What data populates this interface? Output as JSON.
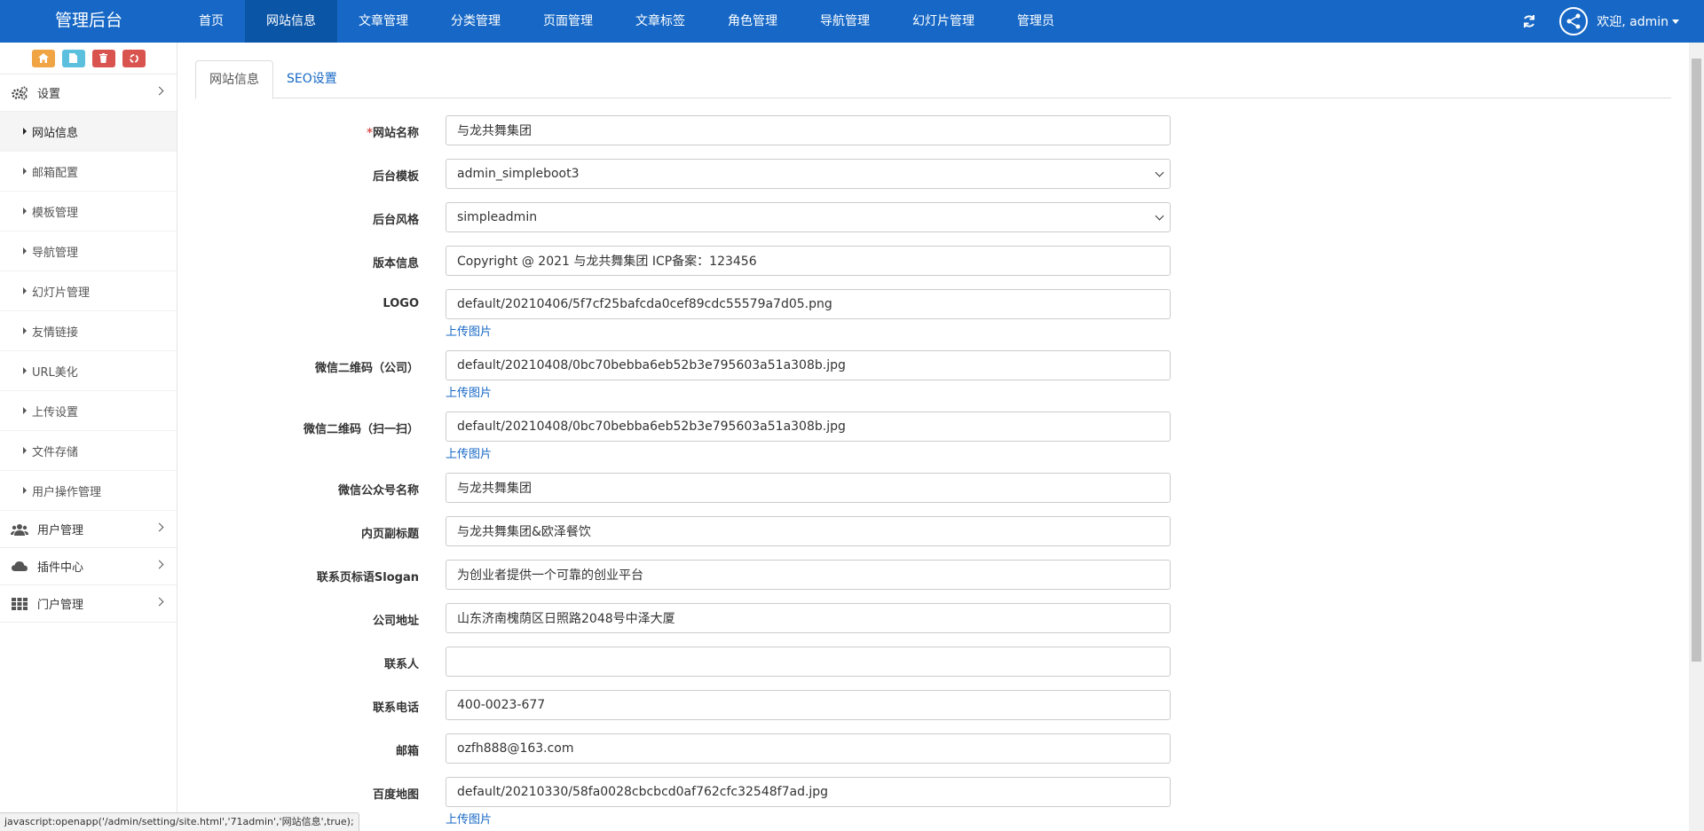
{
  "brand": "管理后台",
  "topnav": [
    "首页",
    "网站信息",
    "文章管理",
    "分类管理",
    "页面管理",
    "文章标签",
    "角色管理",
    "导航管理",
    "幻灯片管理",
    "管理员"
  ],
  "user": {
    "welcome": "欢迎, admin"
  },
  "sidebar": {
    "settings_label": "设置",
    "sub_items": [
      "网站信息",
      "邮箱配置",
      "模板管理",
      "导航管理",
      "幻灯片管理",
      "友情链接",
      "URL美化",
      "上传设置",
      "文件存储",
      "用户操作管理"
    ],
    "groups": [
      "用户管理",
      "插件中心",
      "门户管理"
    ]
  },
  "tabs": {
    "site_info": "网站信息",
    "seo": "SEO设置"
  },
  "form": {
    "upload_label": "上传图片",
    "fields": [
      {
        "label": "网站名称",
        "required": true,
        "value": "与龙共舞集团"
      },
      {
        "label": "后台模板",
        "value": "admin_simpleboot3"
      },
      {
        "label": "后台风格",
        "value": "simpleadmin"
      },
      {
        "label": "版本信息",
        "value": "Copyright @ 2021 与龙共舞集团 ICP备案：123456"
      },
      {
        "label": "LOGO",
        "value": "default/20210406/5f7cf25bafcda0cef89cdc55579a7d05.png"
      },
      {
        "label": "微信二维码（公司）",
        "value": "default/20210408/0bc70bebba6eb52b3e795603a51a308b.jpg"
      },
      {
        "label": "微信二维码（扫一扫）",
        "value": "default/20210408/0bc70bebba6eb52b3e795603a51a308b.jpg"
      },
      {
        "label": "微信公众号名称",
        "value": "与龙共舞集团"
      },
      {
        "label": "内页副标题",
        "value": "与龙共舞集团&欧泽餐饮"
      },
      {
        "label": "联系页标语Slogan",
        "value": "为创业者提供一个可靠的创业平台"
      },
      {
        "label": "公司地址",
        "value": "山东济南槐荫区日照路2048号中泽大厦"
      },
      {
        "label": "联系人",
        "value": ""
      },
      {
        "label": "联系电话",
        "value": "400-0023-677"
      },
      {
        "label": "邮箱",
        "value": "ozfh888@163.com"
      },
      {
        "label": "百度地图",
        "value": "default/20210330/58fa0028cbcbcd0af762cfc32548f7ad.jpg"
      }
    ]
  },
  "statusbar": "javascript:openapp('/admin/setting/site.html','71admin','网站信息',true);",
  "colors": {
    "navbar": "#1768c6",
    "navbar_active": "#0b55a7",
    "link": "#1768c6"
  }
}
